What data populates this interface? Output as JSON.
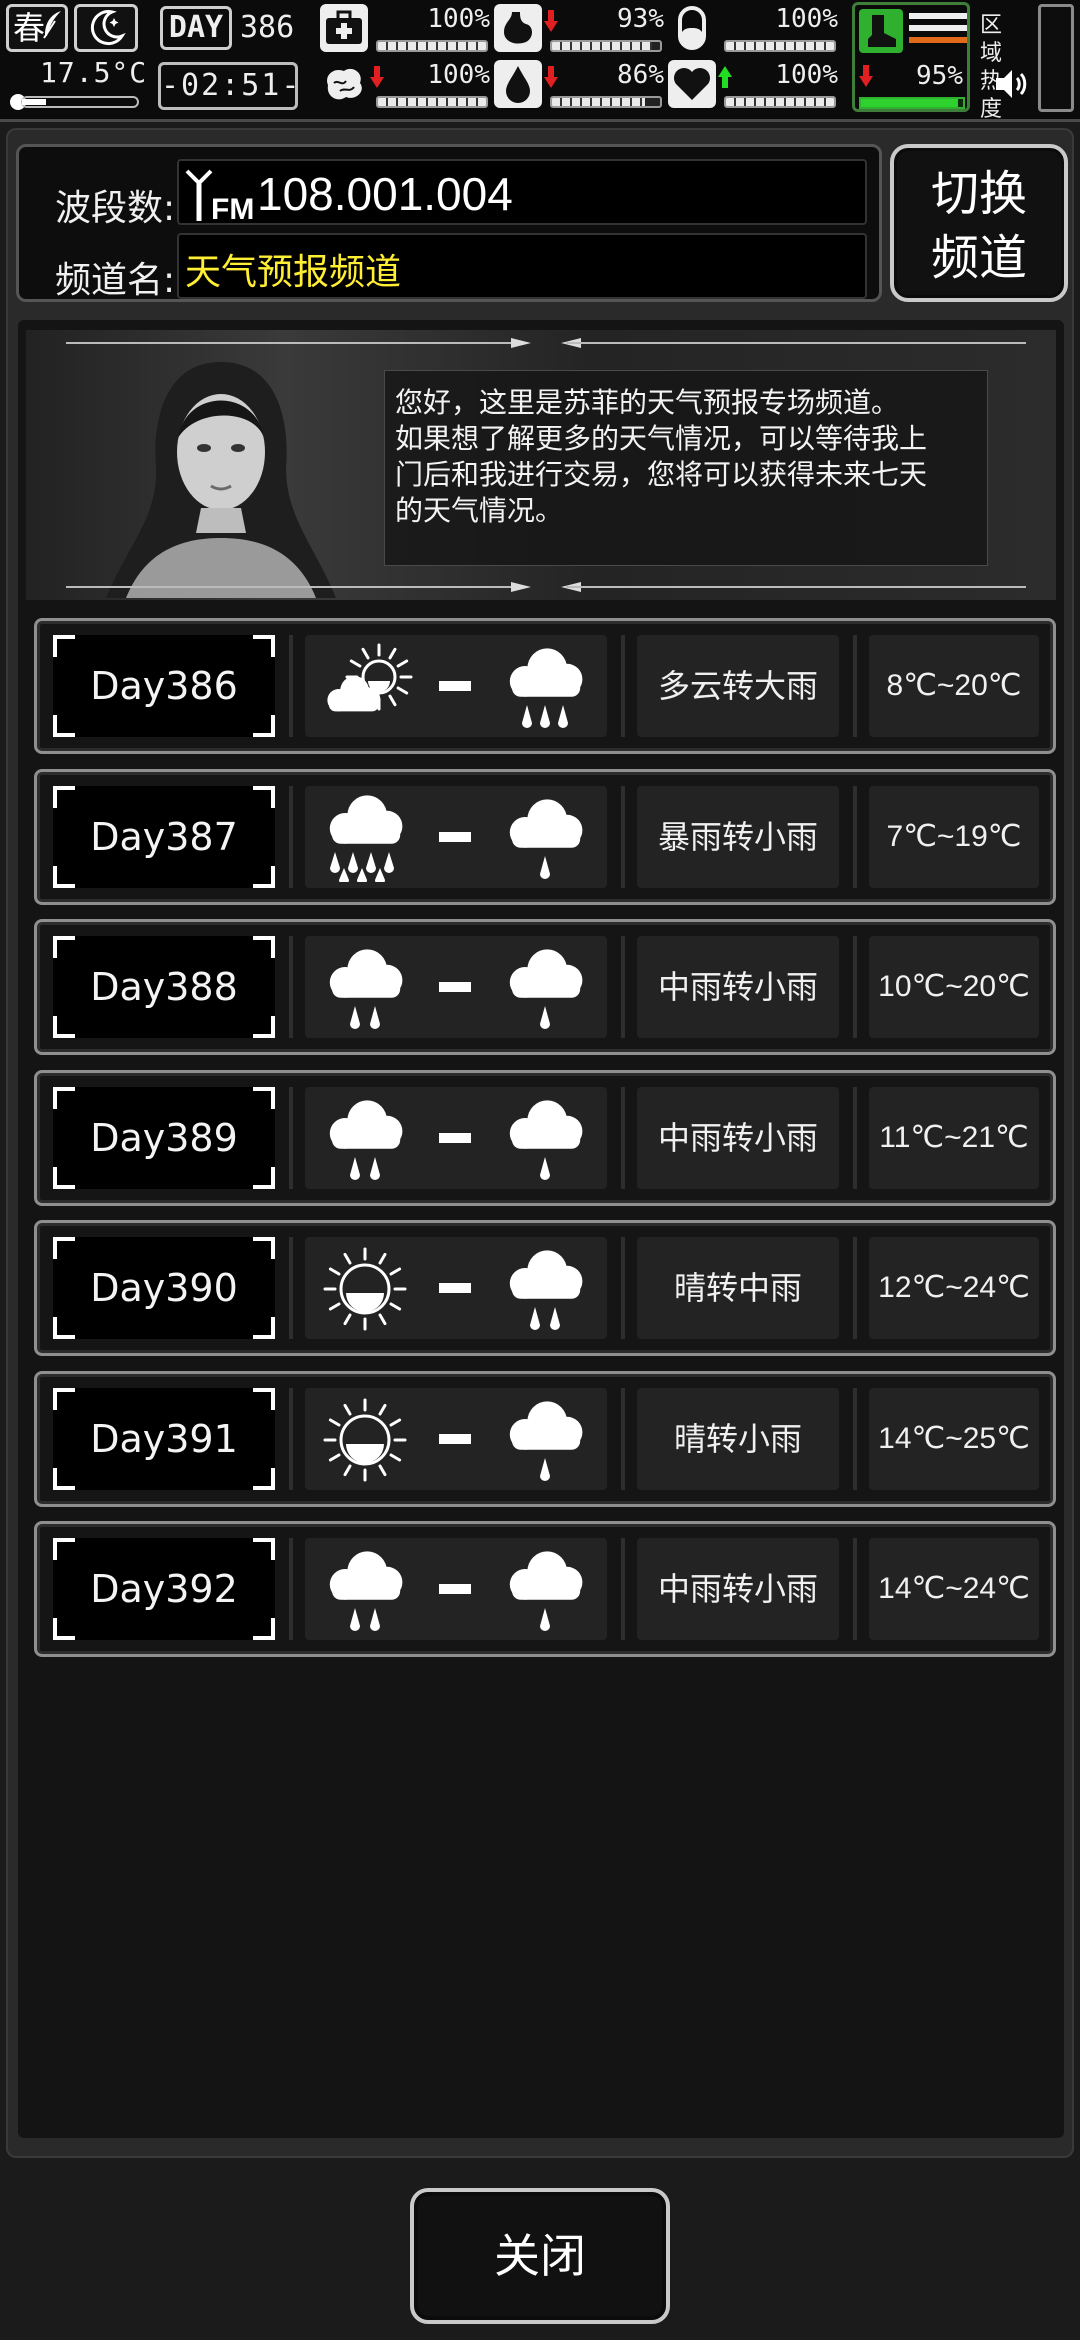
{
  "status": {
    "season": "春",
    "temperature": "17.5°C",
    "day_label": "DAY",
    "day_number": "386",
    "clock": "-02:51-",
    "stats": [
      {
        "name": "health",
        "icon": "medkit-icon",
        "percent": "100%",
        "level": 1.0,
        "arrow": ""
      },
      {
        "name": "hunger",
        "icon": "stomach-icon",
        "percent": "93%",
        "level": 0.93,
        "arrow": "down"
      },
      {
        "name": "pill",
        "icon": "pill-icon",
        "percent": "100%",
        "level": 1.0,
        "arrow": ""
      },
      {
        "name": "sanity",
        "icon": "brain-icon",
        "percent": "100%",
        "level": 1.0,
        "arrow": "down"
      },
      {
        "name": "thirst",
        "icon": "water-drop-icon",
        "percent": "86%",
        "level": 0.86,
        "arrow": "down"
      },
      {
        "name": "mood",
        "icon": "heart-icon",
        "percent": "100%",
        "level": 1.0,
        "arrow": "up"
      }
    ],
    "stamina": {
      "icon": "boot-icon",
      "percent": "95%",
      "level": 0.95,
      "arrow": "down"
    },
    "heat_label": "区域\n热度",
    "colors": {
      "up": "#22dd22",
      "down": "#e02020",
      "stamina": "#2fd12f"
    }
  },
  "radio": {
    "band_label": "波段数:",
    "band_prefix": "FM",
    "frequency": "108.001.004",
    "channel_label": "频道名:",
    "channel_name": "天气预报频道",
    "switch_label_1": "切换",
    "switch_label_2": "频道"
  },
  "banner": {
    "message_lines": [
      "您好，这里是苏菲的天气预报专场频道。",
      "如果想了解更多的天气情况，可以等待我上",
      "门后和我进行交易，您将可以获得未来七天",
      "的天气情况。"
    ]
  },
  "forecast": [
    {
      "day": "Day386",
      "icon_from": "partly-cloudy",
      "icon_to": "heavy-rain",
      "desc": "多云转大雨",
      "temp": "8℃~20℃"
    },
    {
      "day": "Day387",
      "icon_from": "storm",
      "icon_to": "light-rain",
      "desc": "暴雨转小雨",
      "temp": "7℃~19℃"
    },
    {
      "day": "Day388",
      "icon_from": "moderate-rain",
      "icon_to": "light-rain",
      "desc": "中雨转小雨",
      "temp": "10℃~20℃"
    },
    {
      "day": "Day389",
      "icon_from": "moderate-rain",
      "icon_to": "light-rain",
      "desc": "中雨转小雨",
      "temp": "11℃~21℃"
    },
    {
      "day": "Day390",
      "icon_from": "sunny",
      "icon_to": "moderate-rain",
      "desc": "晴转中雨",
      "temp": "12℃~24℃"
    },
    {
      "day": "Day391",
      "icon_from": "sunny",
      "icon_to": "light-rain",
      "desc": "晴转小雨",
      "temp": "14℃~25℃"
    },
    {
      "day": "Day392",
      "icon_from": "moderate-rain",
      "icon_to": "light-rain",
      "desc": "中雨转小雨",
      "temp": "14℃~24℃"
    }
  ],
  "footer": {
    "close_label": "关闭"
  }
}
